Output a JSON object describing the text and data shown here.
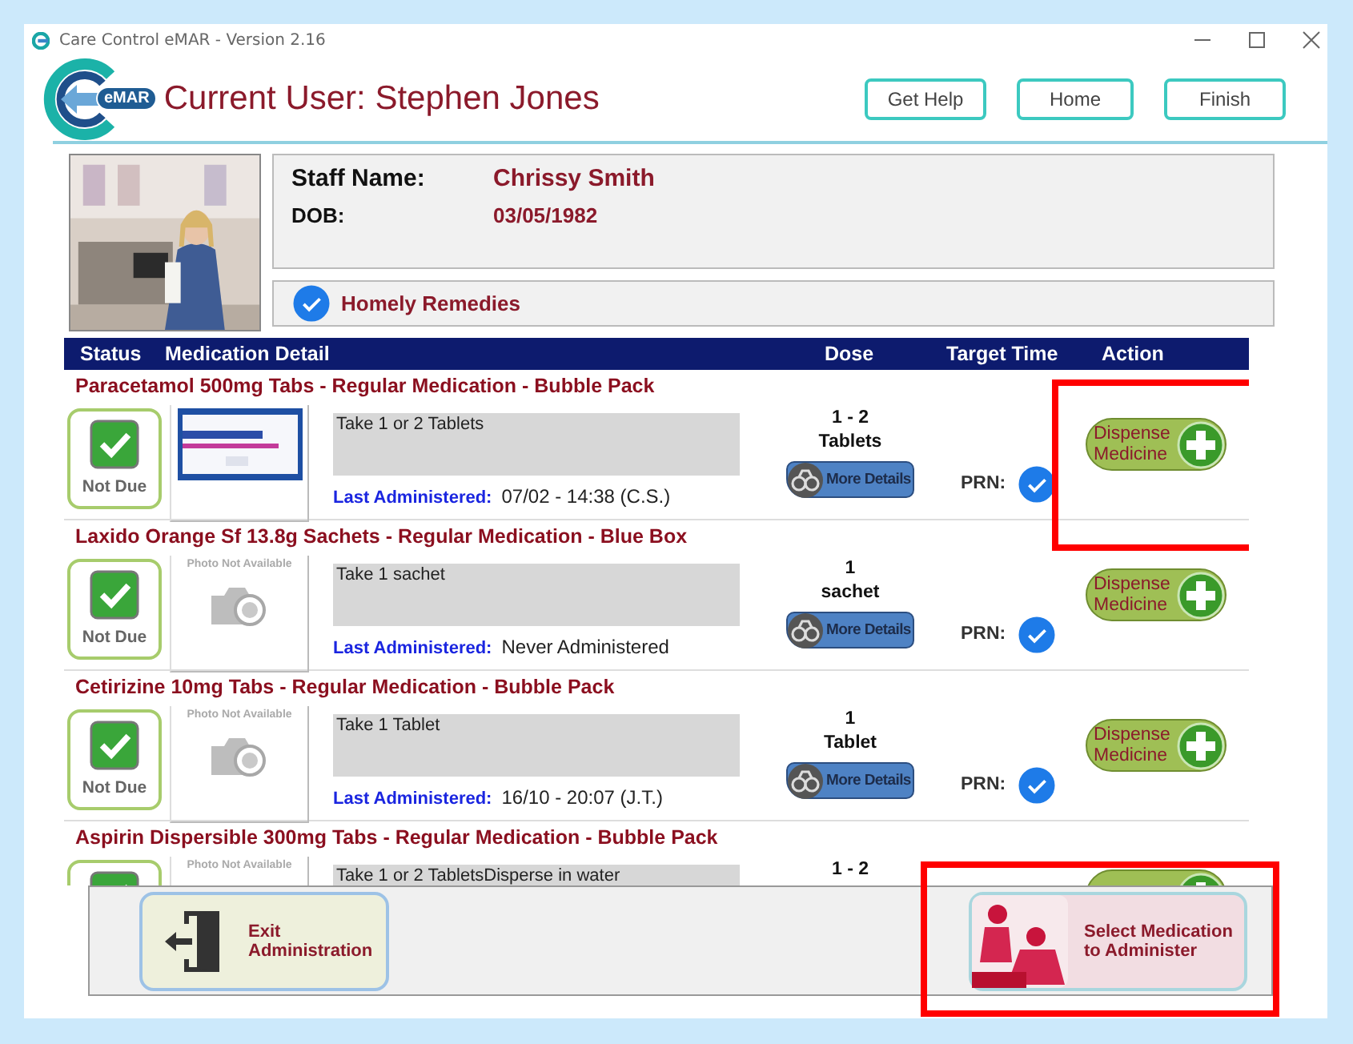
{
  "window": {
    "title": "Care Control eMAR - Version 2.16"
  },
  "header": {
    "logo_text": "eMAR",
    "title": "Current User: Stephen Jones",
    "buttons": [
      "Get Help",
      "Home",
      "Finish"
    ]
  },
  "staff": {
    "photo": {
      "kind": "picture"
    },
    "fields": [
      {
        "label": "Staff Name:",
        "value": "Chrissy Smith"
      },
      {
        "label": "DOB:",
        "value": "03/05/1982"
      }
    ],
    "homely_remedies": {
      "label": "Homely Remedies",
      "checked": true
    }
  },
  "table": {
    "columns": [
      "Status",
      "Medication Detail",
      "Dose",
      "Target Time",
      "Action"
    ],
    "rows": [
      {
        "title": "Paracetamol 500mg Tabs - Regular Medication - Bubble Pack",
        "status": {
          "checked": true,
          "label": "Not Due"
        },
        "photo": {
          "kind": "picture"
        },
        "instructions": "Take 1 or 2 Tablets",
        "last_administered": {
          "label": "Last Administered:",
          "value": "07/02 - 14:38 (C.S.)"
        },
        "dose": [
          "1 - 2",
          "Tablets"
        ],
        "details_button": "More Details",
        "prn": {
          "label": "PRN:",
          "checked": true
        },
        "action": {
          "label": "Dispense Medicine",
          "highlighted": true
        }
      },
      {
        "title": "Laxido Orange Sf 13.8g Sachets - Regular Medication - Blue Box",
        "status": {
          "checked": true,
          "label": "Not Due"
        },
        "photo": {
          "kind": "placeholder",
          "text": "Photo Not Available"
        },
        "instructions": "Take 1 sachet",
        "last_administered": {
          "label": "Last Administered:",
          "value": "Never Administered"
        },
        "dose": [
          "1",
          "sachet"
        ],
        "details_button": "More Details",
        "prn": {
          "label": "PRN:",
          "checked": true
        },
        "action": {
          "label": "Dispense Medicine",
          "highlighted": false
        }
      },
      {
        "title": "Cetirizine 10mg Tabs - Regular Medication - Bubble Pack",
        "status": {
          "checked": true,
          "label": "Not Due"
        },
        "photo": {
          "kind": "placeholder",
          "text": "Photo Not Available"
        },
        "instructions": "Take 1 Tablet",
        "last_administered": {
          "label": "Last Administered:",
          "value": "16/10 - 20:07 (J.T.)"
        },
        "dose": [
          "1",
          "Tablet"
        ],
        "details_button": "More Details",
        "prn": {
          "label": "PRN:",
          "checked": true
        },
        "action": {
          "label": "Dispense Medicine",
          "highlighted": false
        }
      },
      {
        "title": "Aspirin Dispersible 300mg Tabs - Regular Medication - Bubble Pack",
        "status": {
          "checked": true
        },
        "photo": {
          "kind": "placeholder",
          "text": "Photo Not Available"
        },
        "instructions": "Take 1 or 2 TabletsDisperse in water",
        "dose": [
          "1 - 2"
        ],
        "action": {
          "highlighted": false
        }
      }
    ]
  },
  "footer": {
    "buttons": [
      {
        "kind": "exit",
        "label": "Exit Administration",
        "highlighted": false
      },
      {
        "kind": "administer",
        "label": "Select Medication to Administer",
        "highlighted": true
      }
    ]
  }
}
